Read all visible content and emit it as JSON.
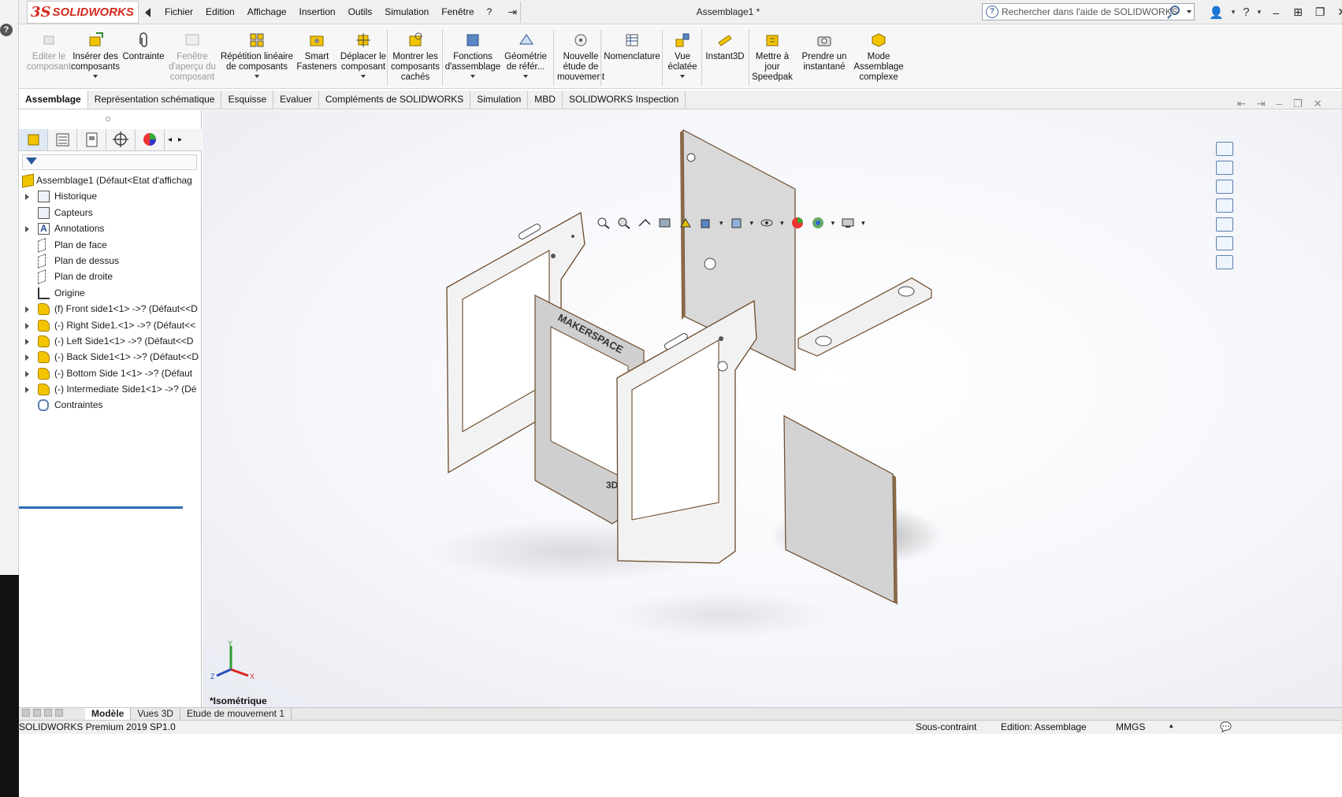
{
  "app": {
    "logo_ds": "3S",
    "logo_text": "SOLIDWORKS",
    "document_title": "Assemblage1 *",
    "search_placeholder": "Rechercher dans l'aide de SOLIDWORKS"
  },
  "menu": [
    "Fichier",
    "Edition",
    "Affichage",
    "Insertion",
    "Outils",
    "Simulation",
    "Fenêtre",
    "?"
  ],
  "ribbon": {
    "edit_component": "Editer le composant",
    "insert_components": "Insérer des composants",
    "mate": "Contrainte",
    "preview_window": "Fenêtre d'aperçu du composant",
    "linear_pattern": "Répétition linéaire de composants",
    "smart_fasteners": "Smart Fasteners",
    "move_component": "Déplacer le composant",
    "show_hidden": "Montrer les composants cachés",
    "assembly_features": "Fonctions d'assemblage",
    "reference_geometry": "Géométrie de référ...",
    "new_motion_study": "Nouvelle étude de mouvement",
    "bom": "Nomenclature",
    "exploded_view": "Vue éclatée",
    "instant3d": "Instant3D",
    "update_speedpak": "Mettre à jour Speedpak",
    "take_snapshot": "Prendre un instantané",
    "large_assembly_mode": "Mode Assemblage complexe"
  },
  "cm_tabs": [
    "Assemblage",
    "Représentation schématique",
    "Esquisse",
    "Evaluer",
    "Compléments de SOLIDWORKS",
    "Simulation",
    "MBD",
    "SOLIDWORKS Inspection"
  ],
  "tree": {
    "root": "Assemblage1  (Défaut<Etat d'affichag",
    "items": [
      {
        "label": "Historique"
      },
      {
        "label": "Capteurs"
      },
      {
        "label": "Annotations"
      },
      {
        "label": "Plan de face"
      },
      {
        "label": "Plan de dessus"
      },
      {
        "label": "Plan de droite"
      },
      {
        "label": "Origine"
      },
      {
        "label": "(f) Front side1<1> ->? (Défaut<<D"
      },
      {
        "label": "(-) Right Side1.<1> ->? (Défaut<<"
      },
      {
        "label": "(-) Left Side1<1> ->? (Défaut<<D"
      },
      {
        "label": "(-) Back Side1<1> ->? (Défaut<<D"
      },
      {
        "label": "(-) Bottom Side 1<1> ->? (Défaut"
      },
      {
        "label": "(-) Intermediate Side1<1> ->? (Dé"
      },
      {
        "label": "Contraintes"
      }
    ]
  },
  "graphics": {
    "view_name": "*Isométrique",
    "panel_text": "MAKERSPACE",
    "panel_text2": "3D",
    "triad": {
      "x": "X",
      "y": "Y",
      "z": "Z"
    }
  },
  "bottom_tabs": [
    "Modèle",
    "Vues 3D",
    "Etude de mouvement 1"
  ],
  "status": {
    "product": "SOLIDWORKS Premium 2019 SP1.0",
    "constraint": "Sous-contraint",
    "mode": "Edition: Assemblage",
    "units": "MMGS"
  },
  "colors": {
    "brand": "#d52b1e",
    "accent_blue": "#2b6cb5",
    "part_fill": "#f3f3f3",
    "edge_brown": "#6b4a2b"
  }
}
